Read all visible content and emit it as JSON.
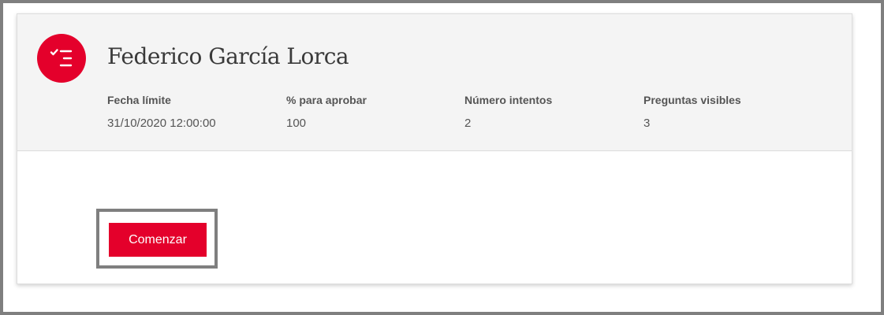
{
  "quiz": {
    "title": "Federico García Lorca",
    "icon": "checklist-icon",
    "accent_color": "#e4002b",
    "header_background": "#f4f4f4"
  },
  "details": [
    {
      "label": "Fecha límite",
      "value": "31/10/2020 12:00:00"
    },
    {
      "label": "% para aprobar",
      "value": "100"
    },
    {
      "label": "Número intentos",
      "value": "2"
    },
    {
      "label": "Preguntas visibles",
      "value": "3"
    }
  ],
  "actions": {
    "start_label": "Comenzar"
  }
}
